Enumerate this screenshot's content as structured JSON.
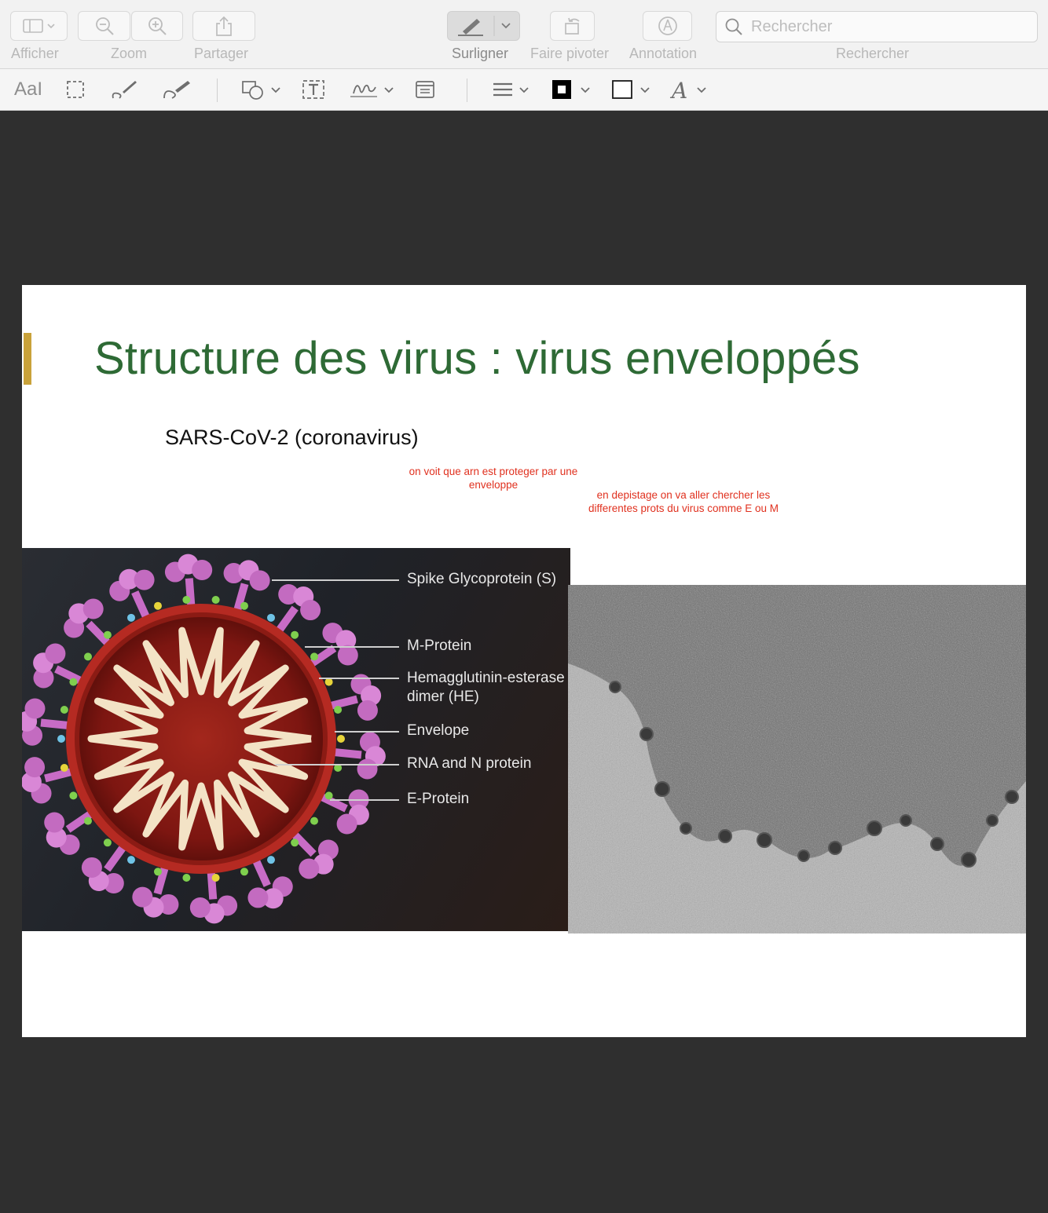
{
  "toolbar": {
    "view_label": "Afficher",
    "zoom_label": "Zoom",
    "share_label": "Partager",
    "highlight_label": "Surligner",
    "rotate_label": "Faire pivoter",
    "annotation_label": "Annotation",
    "search_label": "Rechercher",
    "search_placeholder": "Rechercher",
    "text_style_glyph": "AaI"
  },
  "slide": {
    "title": "Structure des virus : virus enveloppés",
    "subtitle": "SARS-CoV-2 (coronavirus)",
    "notes": [
      "on voit que arn est proteger par une\nenveloppe",
      "en depistage on va aller chercher les\ndifferentes prots du virus comme E ou M"
    ],
    "virus_labels": [
      "Spike Glycoprotein (S)",
      "M-Protein",
      "Hemagglutinin-esterase\ndimer (HE)",
      "Envelope",
      "RNA and N protein",
      "E-Protein"
    ]
  },
  "colors": {
    "title_green": "#2e6a35",
    "accent_gold": "#c9a23a",
    "note_red": "#e0311f",
    "viewer_background": "#2f2f2f"
  }
}
